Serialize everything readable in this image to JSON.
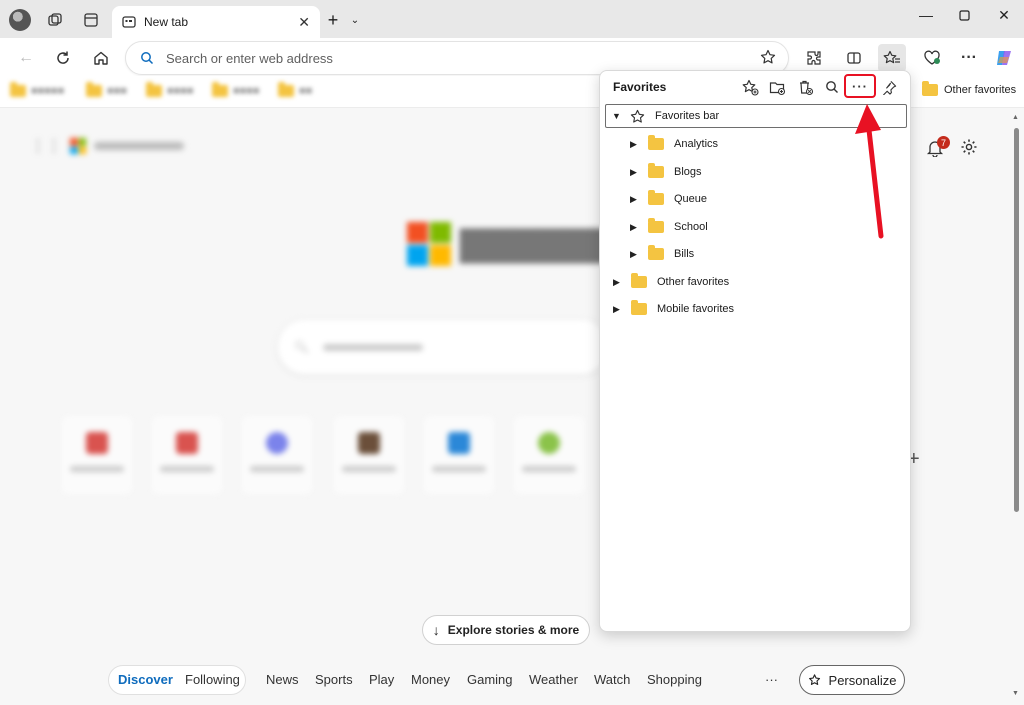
{
  "tab": {
    "title": "New tab"
  },
  "address_bar": {
    "placeholder": "Search or enter web address"
  },
  "favorites_bar": {
    "other_favorites_label": "Other favorites"
  },
  "favorites_panel": {
    "title": "Favorites",
    "tree": [
      {
        "label": "Favorites bar",
        "expanded": true,
        "icon": "star-icon"
      },
      {
        "label": "Analytics",
        "icon": "folder-icon"
      },
      {
        "label": "Blogs",
        "icon": "folder-icon"
      },
      {
        "label": "Queue",
        "icon": "folder-icon"
      },
      {
        "label": "School",
        "icon": "folder-icon"
      },
      {
        "label": "Bills",
        "icon": "folder-icon"
      },
      {
        "label": "Other favorites",
        "icon": "folder-icon"
      },
      {
        "label": "Mobile favorites",
        "icon": "folder-icon"
      }
    ]
  },
  "notifications": {
    "count": "7"
  },
  "explore_button": {
    "label": "Explore stories & more"
  },
  "feed_nav": {
    "items": [
      "Discover",
      "Following",
      "News",
      "Sports",
      "Play",
      "Money",
      "Gaming",
      "Weather",
      "Watch",
      "Shopping"
    ],
    "more": "···",
    "personalize_label": "Personalize"
  },
  "colors": {
    "accent": "#0f6cbd",
    "highlight": "#e81123",
    "folder": "#f4c441"
  }
}
